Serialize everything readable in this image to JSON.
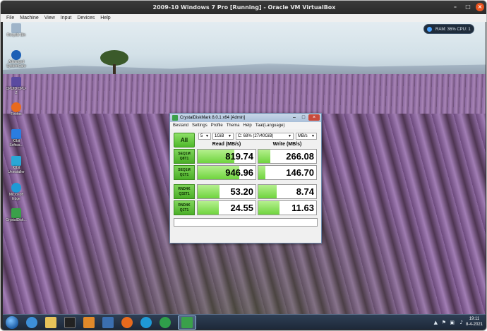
{
  "vm_window": {
    "title": "2009-10 Windows 7 Pro [Running] - Oracle VM VirtualBox"
  },
  "vm_menu": [
    "File",
    "Machine",
    "View",
    "Input",
    "Devices",
    "Help"
  ],
  "desktop_icons": [
    {
      "label": "Recycle Bin",
      "icon": "recycle-bin-icon",
      "color": "#9fb4c9"
    },
    {
      "label": "Advanced SystemCare",
      "icon": "advanced-systemcare-icon",
      "color": "#1c5fb5"
    },
    {
      "label": "CPUID CPU-Z",
      "icon": "cpuz-icon",
      "color": "#5a4aa0"
    },
    {
      "label": "Firefox",
      "icon": "firefox-icon",
      "color": "#e86a1d"
    },
    {
      "label": "IObit Softwa...",
      "icon": "iobit-software-icon",
      "color": "#2a7de1"
    },
    {
      "label": "IObit Uninstaller",
      "icon": "iobit-uninstaller-icon",
      "color": "#2aa7d6"
    },
    {
      "label": "Microsoft Edge",
      "icon": "edge-icon",
      "color": "#1f9ad6"
    },
    {
      "label": "CrystalDisk...",
      "icon": "crystaldiskmark-icon",
      "color": "#3aa04a"
    }
  ],
  "gadget": {
    "text": "RAM: 36%  CPU: 1 %"
  },
  "cdm": {
    "title": "CrystalDiskMark 8.0.1 x64 [Admin]",
    "menu": [
      "Bestand",
      "Settings",
      "Profile",
      "Thema",
      "Help",
      "Taal(Language)"
    ],
    "all_label": "All",
    "count": "5",
    "size": "1GiB",
    "drive": "C: 68% (27/40GiB)",
    "unit": "MB/s",
    "read_header": "Read (MB/s)",
    "write_header": "Write (MB/s)",
    "rows": [
      {
        "l1": "SEQ1M",
        "l2": "Q8T1",
        "read": "819.74",
        "write": "266.08",
        "read_fill": 0.63,
        "write_fill": 0.21
      },
      {
        "l1": "SEQ1M",
        "l2": "Q1T1",
        "read": "946.96",
        "write": "146.70",
        "read_fill": 0.72,
        "write_fill": 0.12
      },
      {
        "l1": "RND4K",
        "l2": "Q32T1",
        "read": "53.20",
        "write": "8.74",
        "read_fill": 0.38,
        "write_fill": 0.32
      },
      {
        "l1": "RND4K",
        "l2": "Q1T1",
        "read": "24.55",
        "write": "11.63",
        "read_fill": 0.37,
        "write_fill": 0.36
      }
    ]
  },
  "taskbar": {
    "apps": [
      {
        "icon": "ie-icon",
        "color": "#3d8fd8"
      },
      {
        "icon": "explorer-icon",
        "color": "#e7c35a"
      },
      {
        "icon": "cmd-icon",
        "color": "#222222"
      },
      {
        "icon": "media-player-icon",
        "color": "#e0892a"
      },
      {
        "icon": "installer-icon",
        "color": "#3b6fb0"
      },
      {
        "icon": "firefox-icon",
        "color": "#e86a1d"
      },
      {
        "icon": "edge-icon",
        "color": "#1f9ad6"
      },
      {
        "icon": "ccleaner-icon",
        "color": "#2f9e4a"
      },
      {
        "icon": "cpuz-icon",
        "color": "#5a4aa0"
      },
      {
        "icon": "crystaldiskmark-icon",
        "color": "#3aa04a"
      }
    ],
    "time": "19:11",
    "date": "8-4-2021"
  }
}
